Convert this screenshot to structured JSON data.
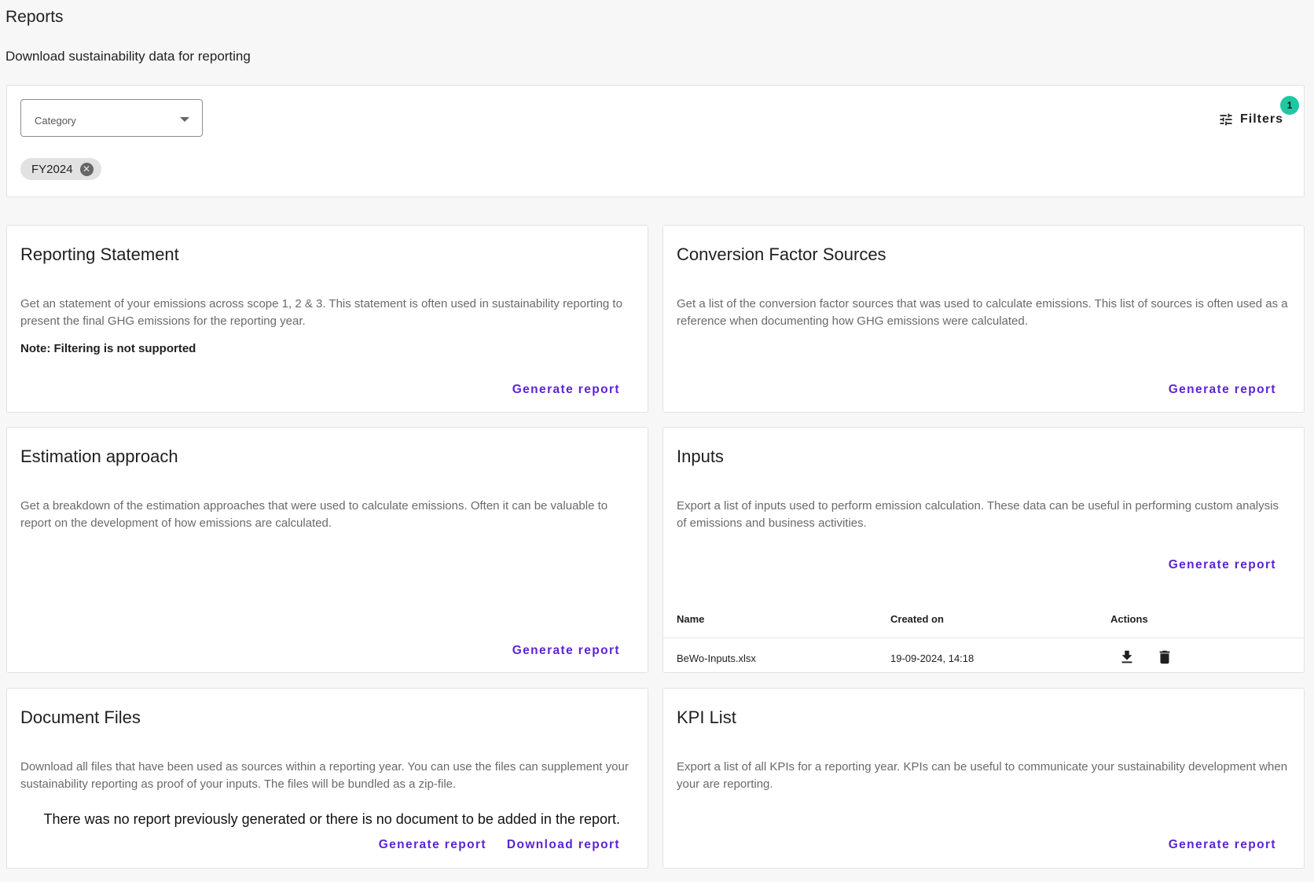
{
  "header": {
    "title": "Reports",
    "subtitle": "Download sustainability data for reporting"
  },
  "filters": {
    "category_label": "Category",
    "chip": "FY2024",
    "button_label": "Filters",
    "badge_count": "1"
  },
  "cards": {
    "reporting_statement": {
      "title": "Reporting Statement",
      "description": "Get an statement of your emissions across scope 1, 2 & 3. This statement is often used in sustainability reporting to present the final GHG emissions for the reporting year.",
      "note": "Note: Filtering is not supported",
      "action": "Generate report"
    },
    "conversion_factor_sources": {
      "title": "Conversion Factor Sources",
      "description": "Get a list of the conversion factor sources that was used to calculate emissions. This list of sources is often used as a reference when documenting how GHG emissions were calculated.",
      "action": "Generate report"
    },
    "estimation_approach": {
      "title": "Estimation approach",
      "description": "Get a breakdown of the estimation approaches that were used to calculate emissions. Often it can be valuable to report on the development of how emissions are calculated.",
      "action": "Generate report"
    },
    "inputs": {
      "title": "Inputs",
      "description": "Export a list of inputs used to perform emission calculation. These data can be useful in performing custom analysis of emissions and business activities.",
      "action": "Generate report",
      "table": {
        "columns": [
          "Name",
          "Created on",
          "Actions"
        ],
        "rows": [
          {
            "name": "BeWo-Inputs.xlsx",
            "created_on": "19-09-2024, 14:18"
          }
        ]
      }
    },
    "document_files": {
      "title": "Document Files",
      "description": "Download all files that have been used as sources within a reporting year. You can use the files can supplement your sustainability reporting as proof of your inputs. The files will be bundled as a zip-file.",
      "empty_message": "There was no report previously generated or there is no document to be added in the report.",
      "action": "Generate report",
      "secondary_action": "Download report"
    },
    "kpi_list": {
      "title": "KPI List",
      "description": "Export a list of all KPIs for a reporting year. KPIs can be useful to communicate your sustainability development when your are reporting.",
      "action": "Generate report"
    }
  },
  "colors": {
    "accent": "#5b23d6",
    "badge": "#1fc8a2",
    "background": "#f7f7f7"
  },
  "icons": [
    "dropdown-caret-icon",
    "close-circle-icon",
    "filter-sliders-icon",
    "download-icon",
    "trash-icon"
  ]
}
